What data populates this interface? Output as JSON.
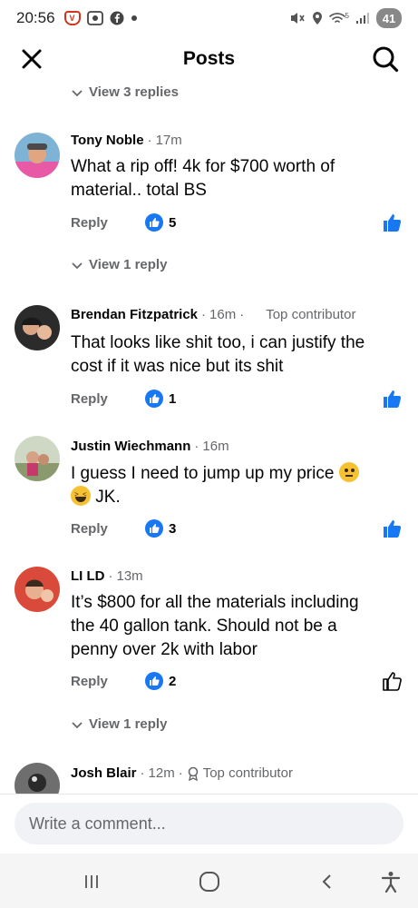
{
  "status_bar": {
    "time": "20:56",
    "network": "5",
    "battery": "41",
    "icons": [
      "vpn-shield-icon",
      "screenshot-icon",
      "facebook-icon",
      "dot-icon",
      "mute-icon",
      "location-icon",
      "wifi-icon",
      "signal-icon"
    ]
  },
  "header": {
    "title": "Posts",
    "close_icon": "close-icon",
    "search_icon": "search-icon"
  },
  "top_replies": {
    "label": "View 3 replies"
  },
  "comments": [
    {
      "name": "Tony Noble",
      "time": "17m",
      "top_contributor": "",
      "text_line1": "What a rip off! 4k for $700 worth of",
      "text_line2": "material.. total BS",
      "reply_label": "Reply",
      "likes": "5",
      "liked": true,
      "view_replies": "View 1 reply"
    },
    {
      "name": "Brendan Fitzpatrick",
      "time": "16m",
      "top_contributor": "Top contributor",
      "text_line1": "That looks like shit too, i can justify the",
      "text_line2": "cost if it was nice but its shit",
      "reply_label": "Reply",
      "likes": "1",
      "liked": true,
      "view_replies": ""
    },
    {
      "name": "Justin Wiechmann",
      "time": "16m",
      "top_contributor": "",
      "text_line1": "I guess I  need to jump up my price",
      "text_line2": "JK.",
      "emoji1": "thinking-face-emoji",
      "emoji2": "grinning-squinting-emoji",
      "reply_label": "Reply",
      "likes": "3",
      "liked": true,
      "view_replies": ""
    },
    {
      "name": "LI LD",
      "time": "13m",
      "top_contributor": "",
      "text_line1": "It’s  $800 for all the materials including",
      "text_line2": "the 40 gallon tank. Should not be a",
      "text_line3": "penny over 2k with labor",
      "reply_label": "Reply",
      "likes": "2",
      "liked": false,
      "view_replies": "View 1 reply"
    },
    {
      "name": "Josh Blair",
      "time": "12m",
      "top_contributor": "Top contributor"
    }
  ],
  "composer": {
    "placeholder": "Write a comment..."
  },
  "nav_bar": {
    "icons": [
      "recent-apps-icon",
      "home-icon",
      "back-icon",
      "accessibility-icon"
    ]
  },
  "colors": {
    "accent": "#1877f2",
    "secondary_text": "#65676b",
    "composer_bg": "#f0f2f5"
  }
}
